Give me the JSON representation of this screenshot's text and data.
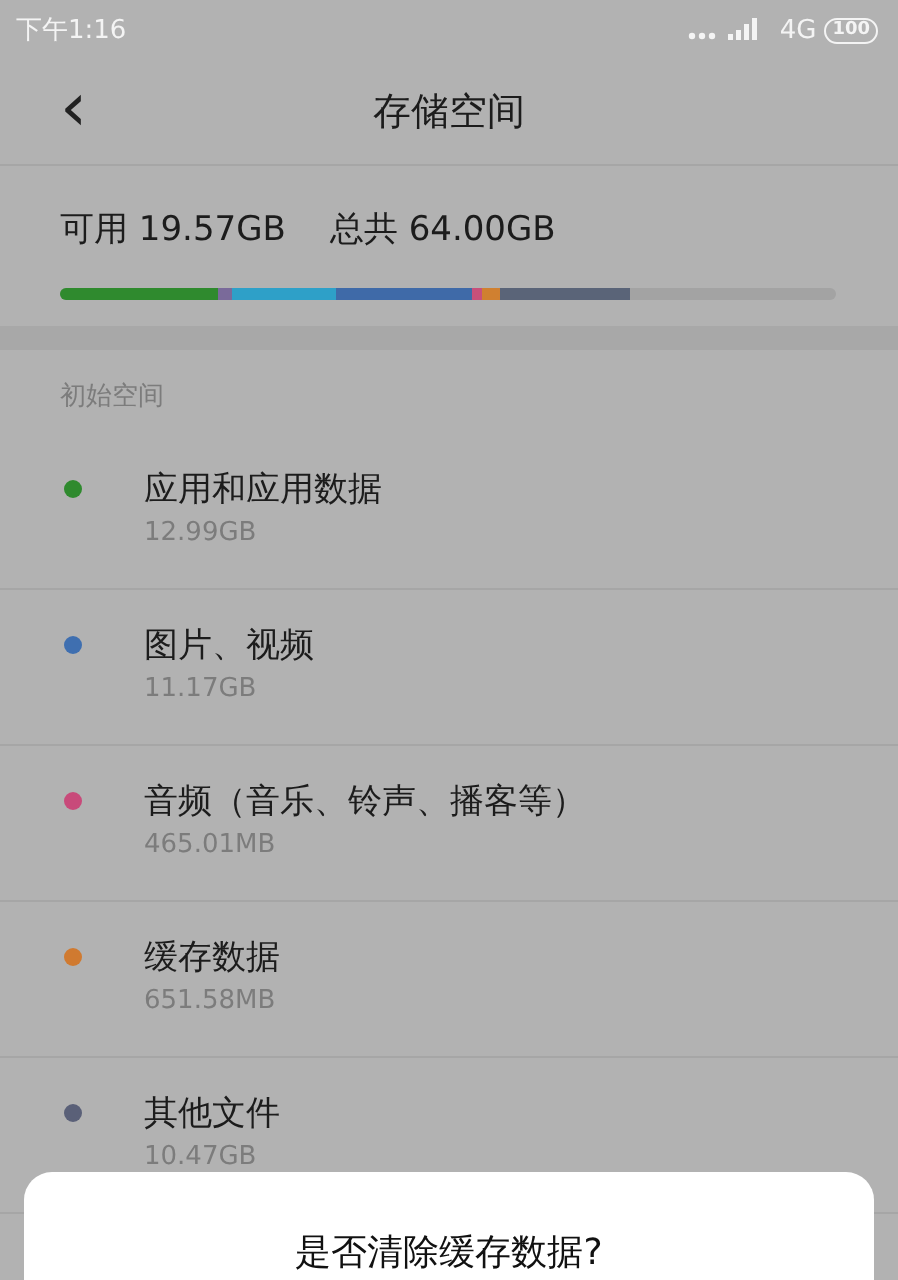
{
  "status_bar": {
    "time": "下午1:16",
    "network": "4G",
    "battery": "100"
  },
  "header": {
    "back": "‹",
    "title": "存储空间"
  },
  "summary": {
    "available": "可用 19.57GB",
    "total": "总共 64.00GB"
  },
  "storage_bar": {
    "segments": [
      {
        "color": "#2f8a2e"
      },
      {
        "color": "#7a6a9a"
      },
      {
        "color": "#2ea0c8"
      },
      {
        "color": "#3f6aa8"
      },
      {
        "color": "#c8507a"
      },
      {
        "color": "#d08030"
      },
      {
        "color": "#5a6478"
      }
    ]
  },
  "section_label": "初始空间",
  "items": [
    {
      "name": "应用和应用数据",
      "size": "12.99GB",
      "color": "#2f8a2e"
    },
    {
      "name": "图片、视频",
      "size": "11.17GB",
      "color": "#3f6fb0"
    },
    {
      "name": "音频（音乐、铃声、播客等）",
      "size": "465.01MB",
      "color": "#c84a7a"
    },
    {
      "name": "缓存数据",
      "size": "651.58MB",
      "color": "#d07a30"
    },
    {
      "name": "其他文件",
      "size": "10.47GB",
      "color": "#5a6078"
    }
  ],
  "dialog": {
    "title": "是否清除缓存数据?"
  }
}
